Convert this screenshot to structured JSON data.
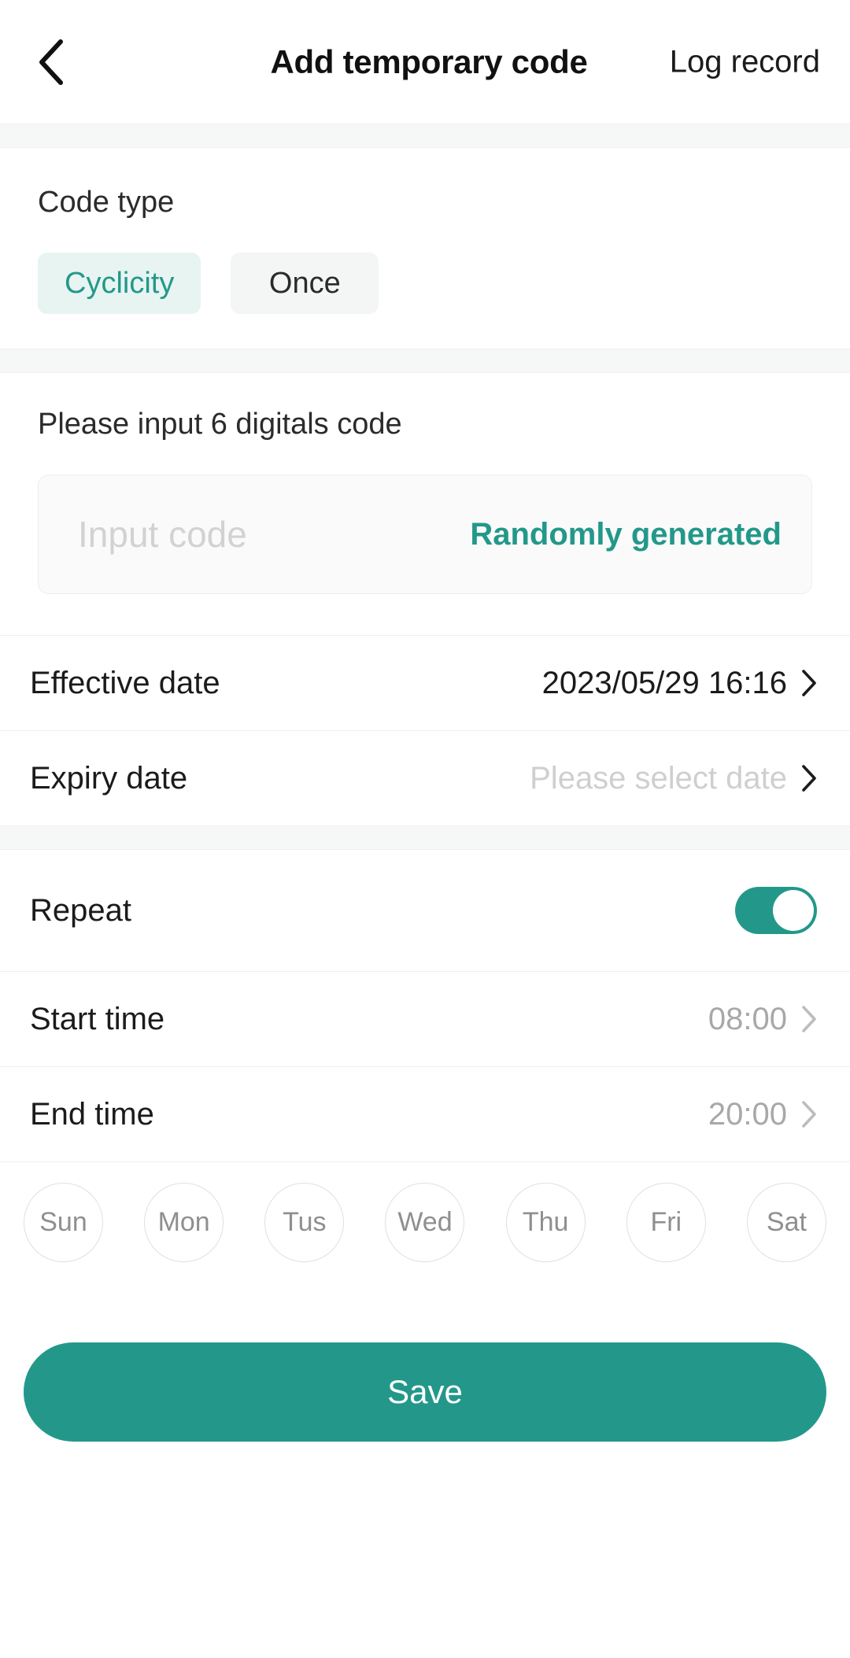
{
  "header": {
    "back_icon": "chevron-left-icon",
    "title": "Add temporary code",
    "action_label": "Log record"
  },
  "code_type": {
    "label": "Code type",
    "options": [
      {
        "label": "Cyclicity",
        "selected": true
      },
      {
        "label": "Once",
        "selected": false
      }
    ]
  },
  "code_input": {
    "hint": "Please input 6 digitals code",
    "placeholder": "Input code",
    "value": "",
    "random_label": "Randomly generated"
  },
  "dates": {
    "effective": {
      "label": "Effective date",
      "value": "2023/05/29 16:16",
      "muted": false
    },
    "expiry": {
      "label": "Expiry date",
      "value": "Please select date",
      "muted": true
    }
  },
  "repeat": {
    "label": "Repeat",
    "enabled": true
  },
  "times": {
    "start": {
      "label": "Start time",
      "value": "08:00"
    },
    "end": {
      "label": "End time",
      "value": "20:00"
    }
  },
  "days": [
    {
      "label": "Sun",
      "selected": false
    },
    {
      "label": "Mon",
      "selected": false
    },
    {
      "label": "Tus",
      "selected": false
    },
    {
      "label": "Wed",
      "selected": false
    },
    {
      "label": "Thu",
      "selected": false
    },
    {
      "label": "Fri",
      "selected": false
    },
    {
      "label": "Sat",
      "selected": false
    }
  ],
  "footer": {
    "save_label": "Save"
  },
  "colors": {
    "accent": "#23988a",
    "accent_soft": "#e7f4f1",
    "chip_grey": "#f4f5f5",
    "band_grey": "#f6f7f7",
    "muted_text": "#cfcfcf",
    "grey_text": "#a8a8a8"
  }
}
